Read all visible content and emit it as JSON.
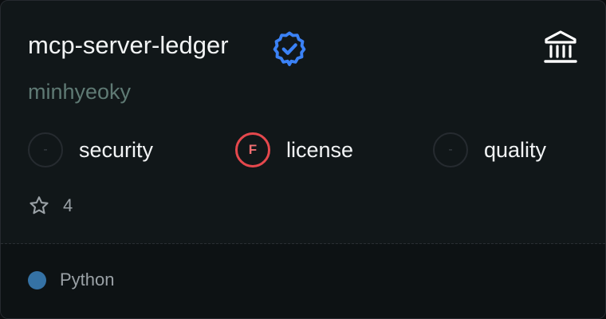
{
  "server": {
    "name": "mcp-server-ledger",
    "author": "minhyeoky",
    "verified_icon": "verified-badge-icon",
    "type_icon": "bank-building-icon"
  },
  "scores": [
    {
      "grade": "-",
      "label": "security"
    },
    {
      "grade": "F",
      "label": "license"
    },
    {
      "grade": "-",
      "label": "quality"
    }
  ],
  "stars": {
    "icon": "star-outline-icon",
    "count": "4"
  },
  "language": {
    "name": "Python",
    "color": "#3572a5"
  },
  "colors": {
    "verified": "#3b82f6",
    "grade_f": "#e5484d",
    "author": "#5f7a74"
  }
}
